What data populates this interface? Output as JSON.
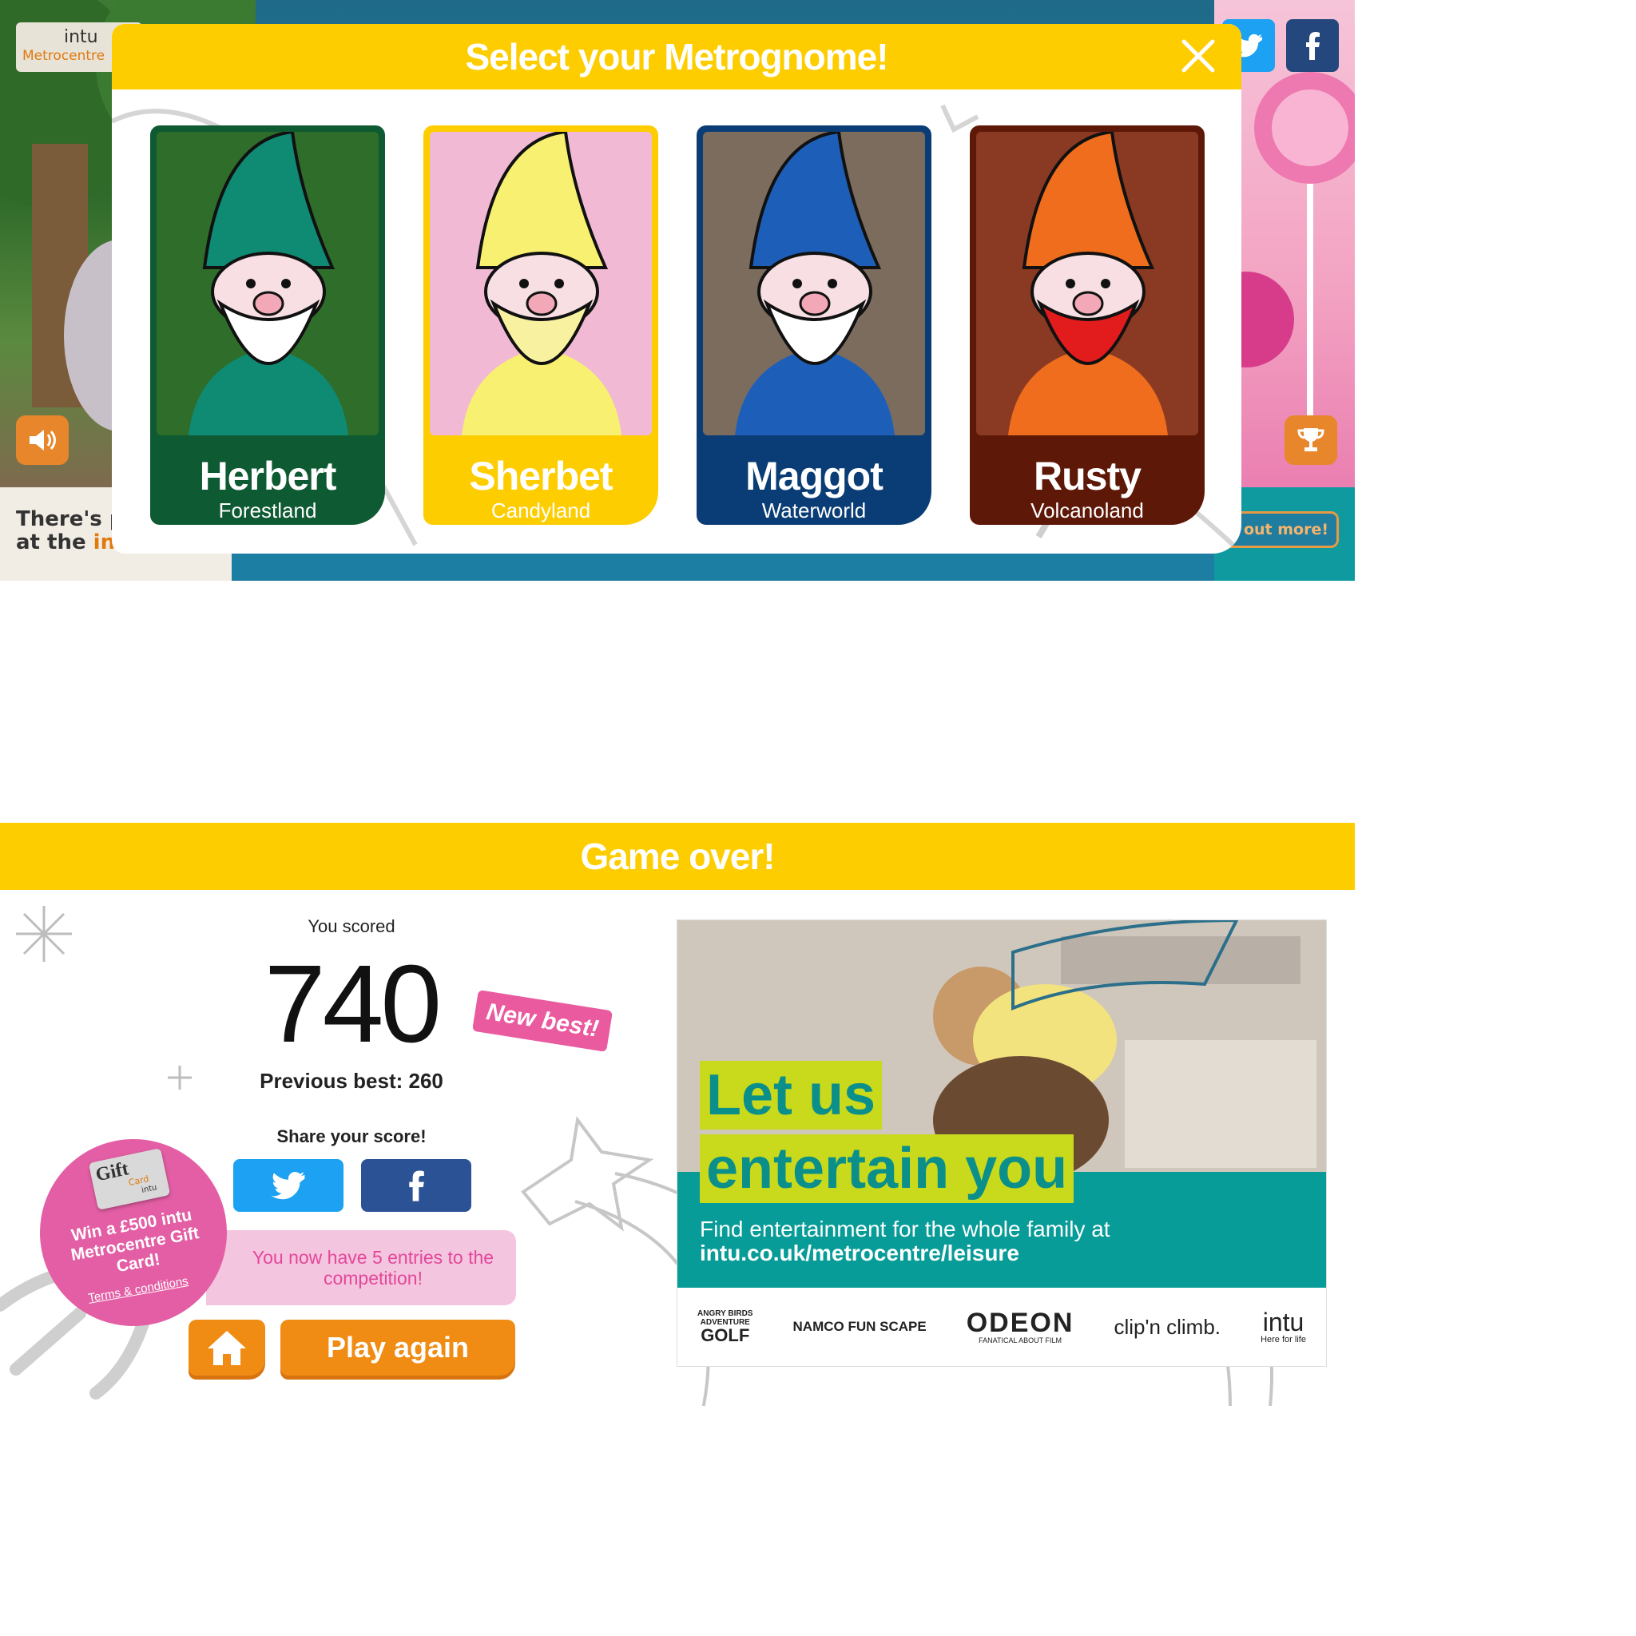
{
  "select_screen": {
    "header": {
      "logo_brand": "intu",
      "logo_location": "Metrocentre"
    },
    "modal_title": "Select your Metrognome!",
    "characters": [
      {
        "name": "Herbert",
        "land": "Forestland",
        "color": "#0e5a32",
        "hat_color": "#0f8a73",
        "bg_color": "#2f6d2a"
      },
      {
        "name": "Sherbet",
        "land": "Candyland",
        "color": "#fdcd00",
        "hat_color": "#f8f070",
        "bg_color": "#f2b9d4"
      },
      {
        "name": "Maggot",
        "land": "Waterworld",
        "color": "#0a3d75",
        "hat_color": "#1d5fb8",
        "bg_color": "#7c6c5e"
      },
      {
        "name": "Rusty",
        "land": "Volcanoland",
        "color": "#5e1808",
        "hat_color": "#ef6d1c",
        "bg_color": "#8a3a22"
      }
    ],
    "background_text_line1": "There's pl",
    "background_text_line2a": "at the ",
    "background_text_line2b": "int",
    "find_out_more": "d out more!"
  },
  "game_over_screen": {
    "title": "Game over!",
    "you_scored_label": "You scored",
    "score": "740",
    "new_best_badge": "New best!",
    "previous_best": "Previous best: 260",
    "share_label": "Share your score!",
    "entries_text": "You now have 5 entries to the competition!",
    "gift": {
      "card_word": "Gift",
      "card_sub": "Card",
      "card_brand": "intu",
      "promo": "Win a £500 intu Metrocentre Gift Card!",
      "terms": "Terms & conditions"
    },
    "play_again": "Play again",
    "ad": {
      "headline_line1": "Let us",
      "headline_line2": "entertain you",
      "body_plain": "Find entertainment for the whole family at ",
      "body_link": "intu.co.uk/metrocentre/leisure",
      "logos": {
        "adventure_golf": [
          "ANGRY BIRDS",
          "ADVENTURE",
          "GOLF"
        ],
        "namco": "NAMCO FUN SCAPE",
        "odeon": "ODEON",
        "odeon_tag": "FANATICAL ABOUT FILM",
        "clip_climb": "clip'n climb.",
        "intu": "intu",
        "intu_tag": "Here for life"
      }
    }
  }
}
